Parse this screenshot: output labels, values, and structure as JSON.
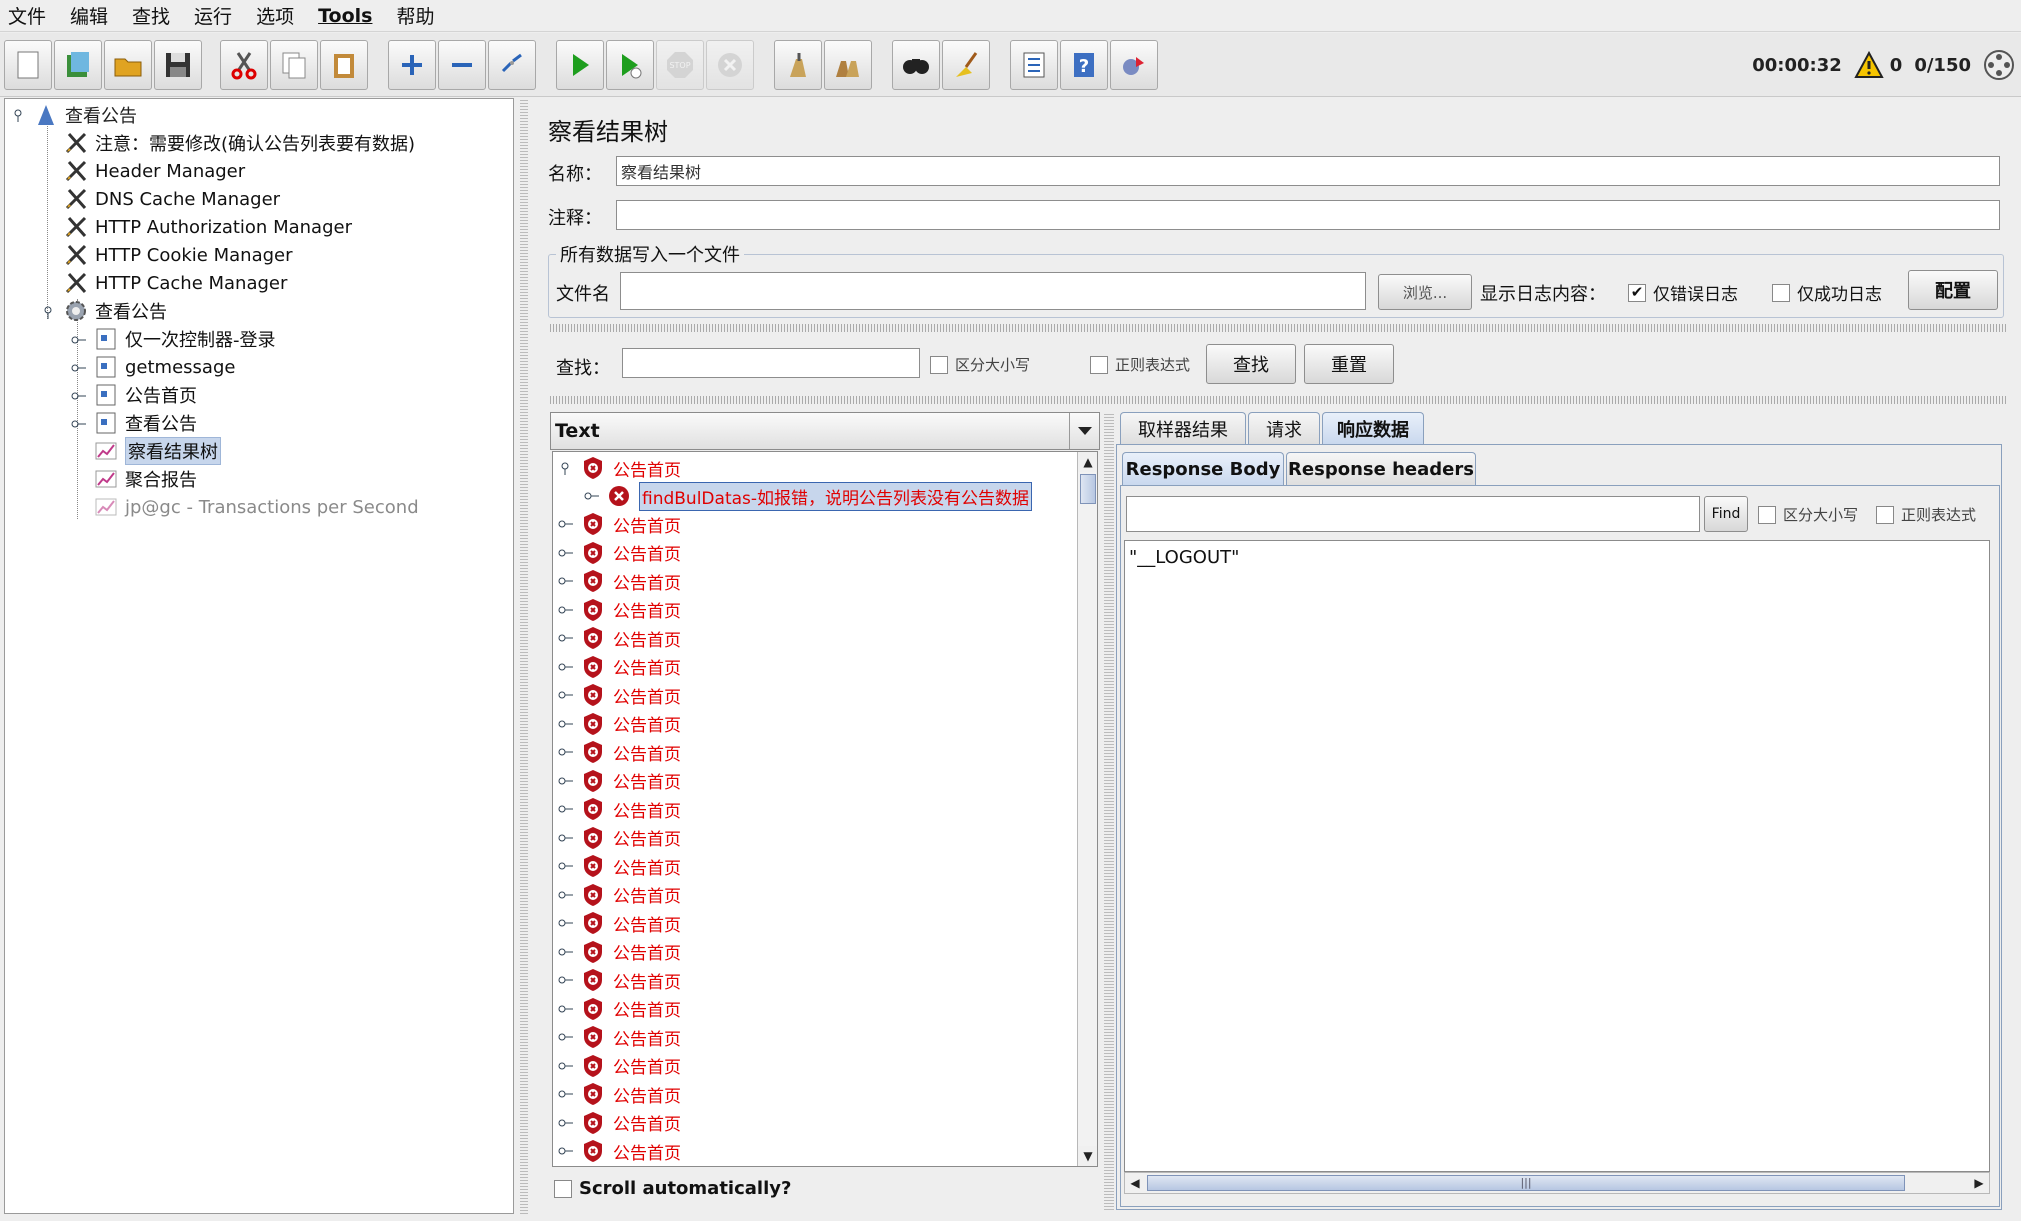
{
  "menu": [
    "文件",
    "编辑",
    "查找",
    "运行",
    "选项",
    "Tools",
    "帮助"
  ],
  "toolbar": {
    "timer": "00:00:32",
    "warning_count": "0",
    "threads": "0/150"
  },
  "tree": {
    "root": "查看公告",
    "items": [
      {
        "label": "注意：需要修改(确认公告列表要有数据)"
      },
      {
        "label": "Header Manager"
      },
      {
        "label": "DNS Cache Manager"
      },
      {
        "label": "HTTP Authorization Manager"
      },
      {
        "label": "HTTP Cookie Manager"
      },
      {
        "label": "HTTP Cache Manager"
      },
      {
        "label": "查看公告"
      },
      {
        "label": "仅一次控制器-登录"
      },
      {
        "label": "getmessage"
      },
      {
        "label": "公告首页"
      },
      {
        "label": "查看公告"
      },
      {
        "label": "察看结果树"
      },
      {
        "label": "聚合报告"
      },
      {
        "label": "jp@gc - Transactions per Second"
      }
    ]
  },
  "panel": {
    "title": "察看结果树",
    "name_label": "名称：",
    "name_value": "察看结果树",
    "comment_label": "注释：",
    "comment_value": "",
    "file_group": "所有数据写入一个文件",
    "filename_label": "文件名",
    "filename_value": "",
    "browse": "浏览...",
    "log_label": "显示日志内容：",
    "errors_only": "仅错误日志",
    "success_only": "仅成功日志",
    "config": "配置",
    "search_label": "查找：",
    "search_value": "",
    "case_sensitive": "区分大小写",
    "regex": "正则表达式",
    "find": "查找",
    "reset": "重置"
  },
  "results": {
    "renderer": "Text",
    "first": "公告首页",
    "child": "findBulDatas-如报错，说明公告列表没有公告数据",
    "rows": [
      "公告首页",
      "公告首页",
      "公告首页",
      "公告首页",
      "公告首页",
      "公告首页",
      "公告首页",
      "公告首页",
      "公告首页",
      "公告首页",
      "公告首页",
      "公告首页",
      "公告首页",
      "公告首页",
      "公告首页",
      "公告首页",
      "公告首页",
      "公告首页",
      "公告首页",
      "公告首页",
      "公告首页",
      "公告首页",
      "公告首页"
    ],
    "scroll_auto": "Scroll automatically?"
  },
  "detail": {
    "tabs": [
      "取样器结果",
      "请求",
      "响应数据"
    ],
    "subtabs": [
      "Response Body",
      "Response headers"
    ],
    "find_value": "",
    "find_btn": "Find",
    "case_sensitive": "区分大小写",
    "regex": "正则表达式",
    "body": "\"__LOGOUT\""
  },
  "colors": {
    "error": "#e00000",
    "selection": "#c7d6ec",
    "tab_border": "#8aa0bd"
  }
}
